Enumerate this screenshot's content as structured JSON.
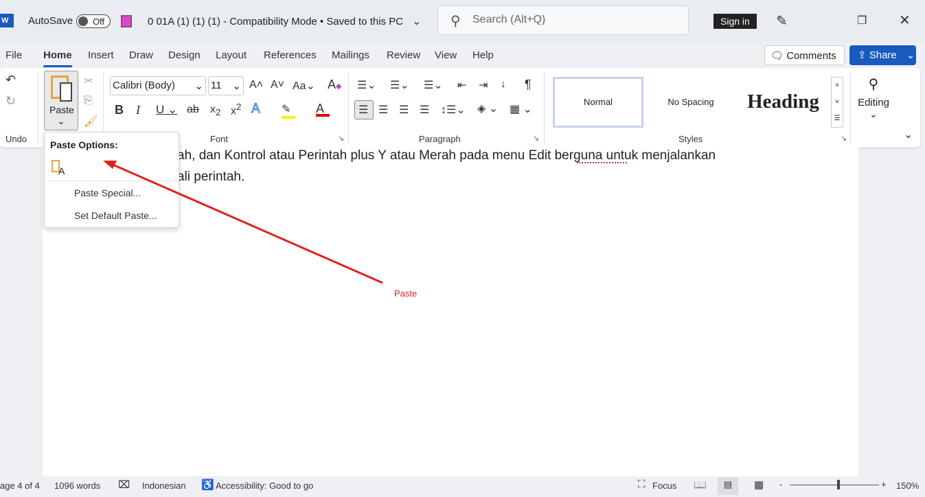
{
  "titlebar": {
    "autosave_label": "AutoSave",
    "autosave_state": "Off",
    "doc_title": "0  01A (1) (1) (1)  -  Compatibility Mode • Saved to this PC",
    "search_placeholder": "Search (Alt+Q)",
    "sign_in": "Sign in"
  },
  "tabs": [
    "File",
    "Home",
    "Insert",
    "Draw",
    "Design",
    "Layout",
    "References",
    "Mailings",
    "Review",
    "View",
    "Help"
  ],
  "actions": {
    "comments": "Comments",
    "share": "Share"
  },
  "ribbon": {
    "undo_label": "Undo",
    "paste_label": "Paste",
    "font_label": "Font",
    "paragraph_label": "Paragraph",
    "styles_label": "Styles",
    "editing_label": "Editing",
    "font_name": "Calibri (Body)",
    "font_size": "11",
    "styles": [
      "Normal",
      "No Spacing",
      "Heading"
    ]
  },
  "paste_menu": {
    "title": "Paste Options:",
    "items": [
      "Paste Special...",
      "Set Default Paste..."
    ]
  },
  "document": {
    "line1": "ah, dan Kontrol atau Perintah plus Y atau Merah pada menu Edit berguna untuk menjalankan",
    "line2": "ali perintah.",
    "annotation": "Paste"
  },
  "status": {
    "page": "age 4 of 4",
    "words": "1096 words",
    "language": "Indonesian",
    "accessibility": "Accessibility: Good to go",
    "focus": "Focus",
    "zoom": "150%",
    "zoom_minus": "-",
    "zoom_plus": "+"
  },
  "colors": {
    "accent": "#185abd",
    "annotation": "#e02020",
    "highlight": "#ffee00",
    "font_color": "#e00000"
  }
}
